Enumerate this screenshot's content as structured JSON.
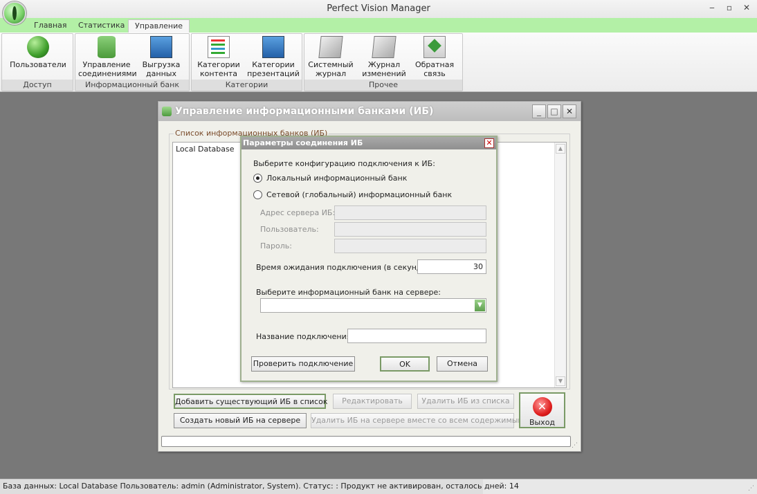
{
  "app": {
    "title": "Perfect Vision Manager"
  },
  "window_controls": {
    "minimize": "‒",
    "maximize": "▫",
    "close": "✕"
  },
  "tabs": [
    {
      "label": "Главная",
      "active": false
    },
    {
      "label": "Статистика",
      "active": false
    },
    {
      "label": "Управление",
      "active": true
    }
  ],
  "ribbon": {
    "groups": [
      {
        "caption": "Доступ",
        "buttons": [
          {
            "label": "Пользователи",
            "icon": "users-icon"
          }
        ]
      },
      {
        "caption": "Информационный банк",
        "buttons": [
          {
            "label": "Управление соединениями",
            "icon": "database-gear-icon"
          },
          {
            "label": "Выгрузка данных",
            "icon": "database-export-icon"
          }
        ]
      },
      {
        "caption": "Категории",
        "buttons": [
          {
            "label": "Категории контента",
            "icon": "content-list-icon"
          },
          {
            "label": "Категории презентаций",
            "icon": "presentation-list-icon"
          }
        ]
      },
      {
        "caption": "Прочее",
        "buttons": [
          {
            "label": "Системный журнал",
            "icon": "system-log-icon"
          },
          {
            "label": "Журнал изменений",
            "icon": "changes-log-icon"
          },
          {
            "label": "Обратная связь",
            "icon": "feedback-mail-icon"
          }
        ]
      }
    ]
  },
  "ib_dialog": {
    "title": "Управление информационными банками (ИБ)",
    "list_legend": "Список информационных банков (ИБ)",
    "list_items": [
      "Local Database"
    ],
    "buttons": {
      "add_existing": "Добавить существующий ИБ в список",
      "edit": "Редактировать",
      "remove_from_list": "Удалить ИБ из списка",
      "create_new": "Создать новый ИБ на сервере",
      "delete_on_server": "Удалить ИБ на сервере вместе со всем содержимым",
      "exit": "Выход"
    }
  },
  "conn_dialog": {
    "title": "Параметры соединения ИБ",
    "prompt": "Выберите конфигурацию подключения к ИБ:",
    "radio_local": "Локальный информационный банк",
    "radio_network": "Сетевой (глобальный) информационный банк",
    "selected": "local",
    "server_address_label": "Адрес сервера ИБ:",
    "server_address_value": "",
    "user_label": "Пользователь:",
    "user_value": "",
    "password_label": "Пароль:",
    "password_value": "",
    "timeout_label": "Время ожидания подключения (в секундах):",
    "timeout_value": "30",
    "select_bank_label": "Выберите информационный банк на сервере:",
    "select_bank_value": "",
    "connection_name_label": "Название подключения:",
    "connection_name_value": "",
    "test_button": "Проверить подключение",
    "ok_button": "OK",
    "cancel_button": "Отмена"
  },
  "status": {
    "text": "База данных: Local Database      Пользователь: admin (Administrator, System).    Статус: : Продукт не активирован, осталось дней: 14"
  },
  "colors": {
    "tab_strip": "#b3f0a6",
    "accent_green": "#7a9a66",
    "workspace": "#787878"
  }
}
